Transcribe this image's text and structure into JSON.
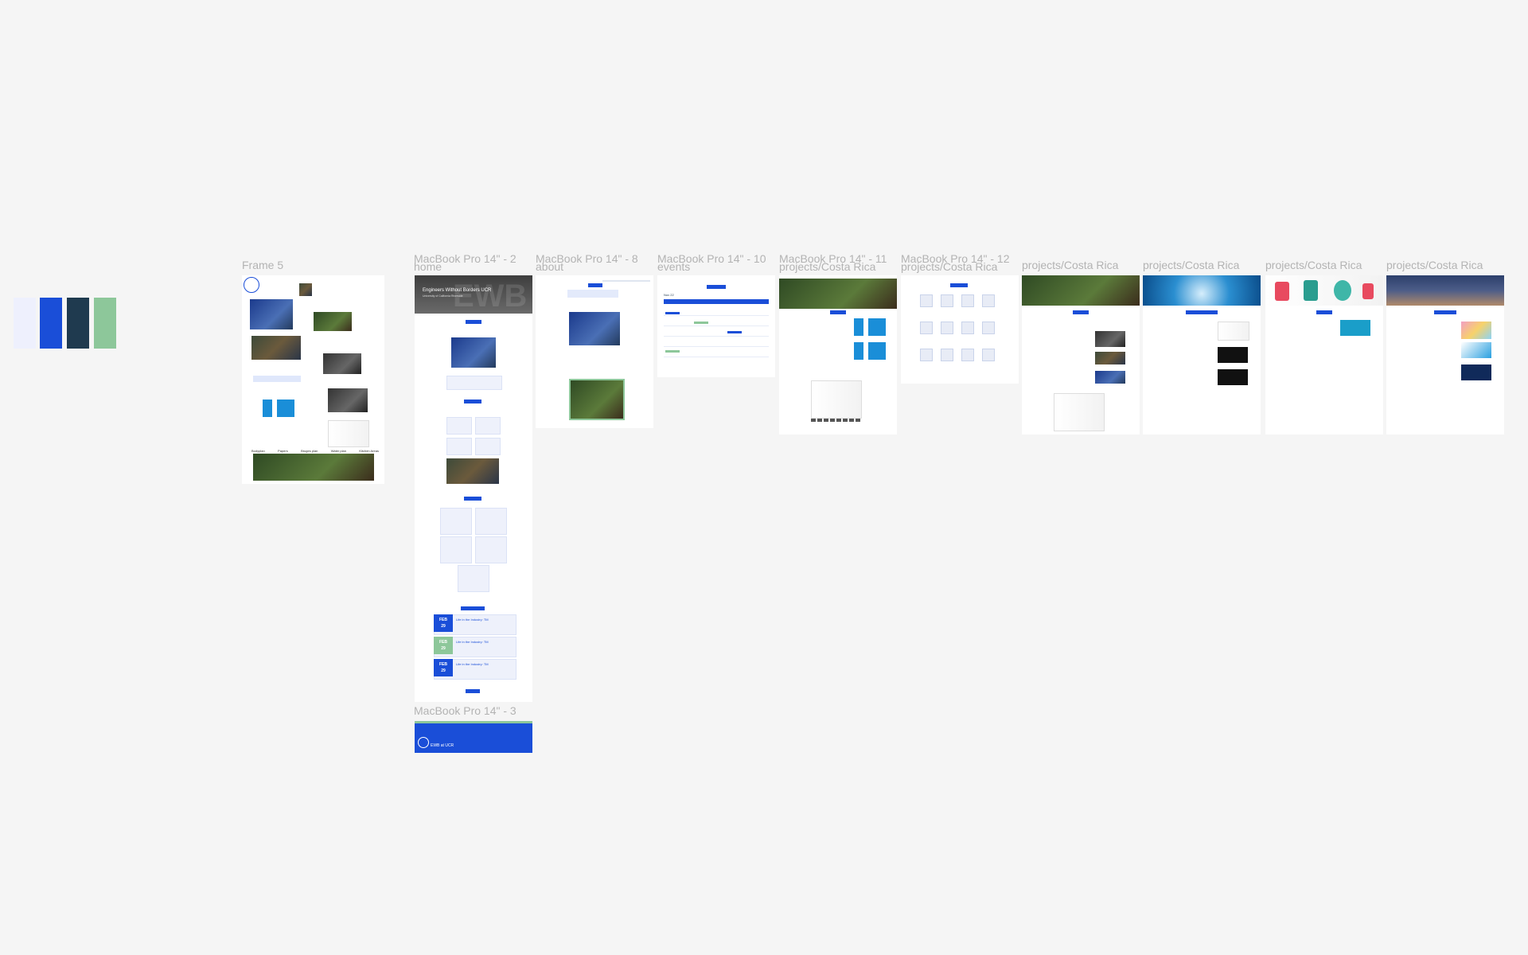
{
  "palette": {
    "colors": [
      "#eef0fd",
      "#1a4ed8",
      "#1f3a4f",
      "#8dc79a"
    ]
  },
  "frames": {
    "frame5": {
      "label": "Frame 5"
    },
    "home": {
      "label": "MacBook Pro 14\" - 2",
      "sublabel": "home"
    },
    "about": {
      "label": "MacBook Pro 14\" - 8",
      "sublabel": "about"
    },
    "events": {
      "label": "MacBook Pro 14\" - 10",
      "sublabel": "events"
    },
    "costarica11": {
      "label": "MacBook Pro 14\" - 11",
      "sublabel": "projects/Costa Rica"
    },
    "costarica12": {
      "label": "MacBook Pro 14\" - 12",
      "sublabel": "projects/Costa Rica"
    },
    "costarica_a": {
      "label": "projects/Costa Rica"
    },
    "costarica_b": {
      "label": "projects/Costa Rica"
    },
    "costarica_c": {
      "label": "projects/Costa Rica"
    },
    "costarica_d": {
      "label": "projects/Costa Rica"
    },
    "footer": {
      "label": "MacBook Pro 14\" - 3"
    }
  },
  "frame5_content": {
    "tabs": [
      "Bodyplan",
      "Papers",
      "Bruges plan",
      "Water plan",
      "Kitchen Areas"
    ]
  },
  "home_content": {
    "hero_title": "Engineers Without Borders UCR",
    "hero_sub": "University of California Riverside",
    "hero_watermark": "EWB",
    "events": [
      {
        "month": "FEB",
        "day": "29",
        "title": "Life in the Industry: TM"
      },
      {
        "month": "FEB",
        "day": "29",
        "title": "Life in the Industry: TM"
      },
      {
        "month": "FEB",
        "day": "29",
        "title": "Life in the Industry: TM"
      }
    ]
  },
  "events_content": {
    "month_title": "Nov 22"
  },
  "footer_content": {
    "brand": "EWB at UCR"
  }
}
